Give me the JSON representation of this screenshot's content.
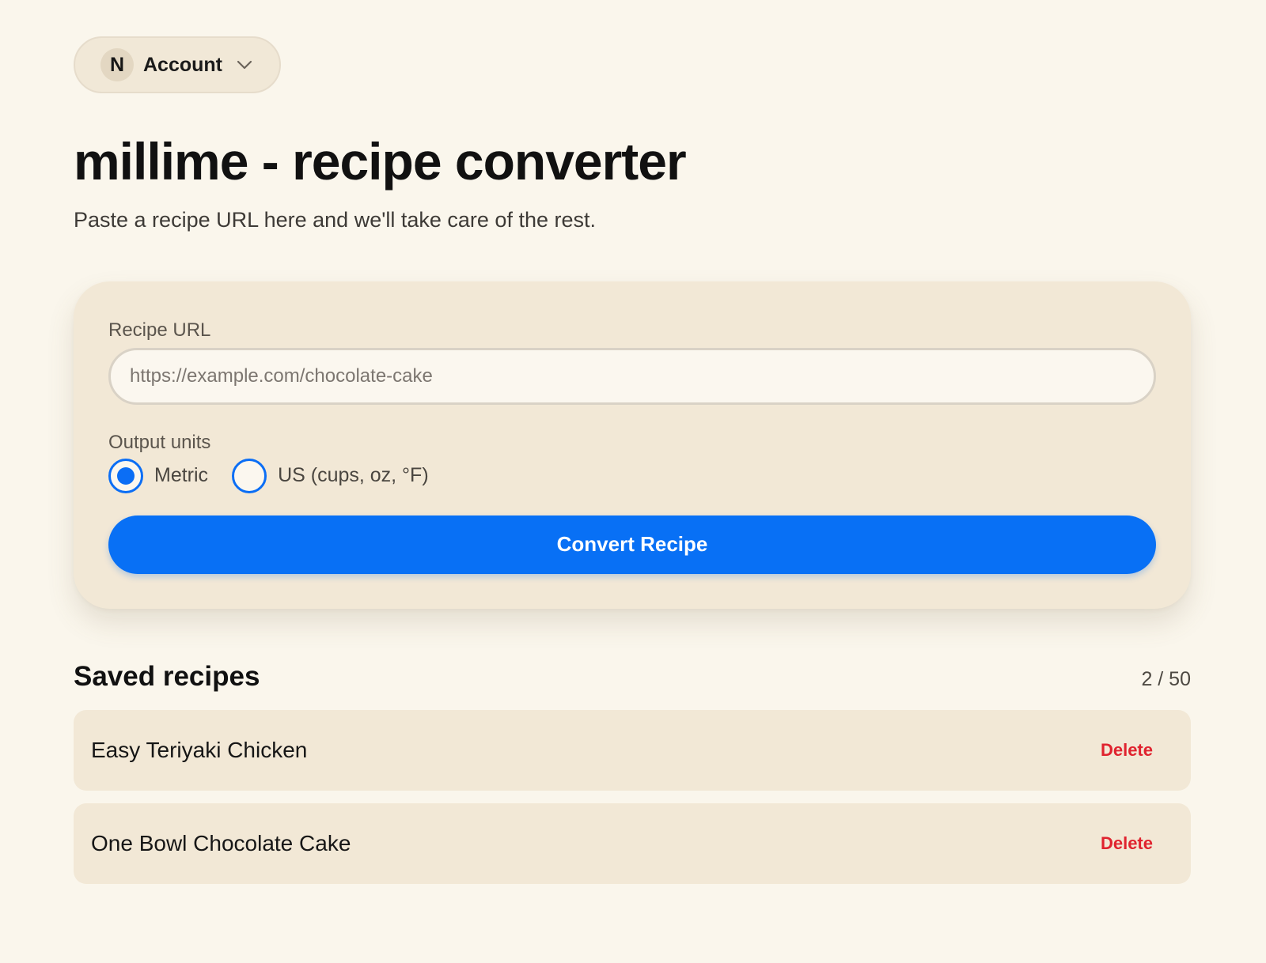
{
  "account": {
    "avatar_initial": "N",
    "label": "Account",
    "chevron_icon": "chevron-down-icon"
  },
  "header": {
    "title": "millime - recipe converter",
    "subtitle": "Paste a recipe URL here and we'll take care of the rest."
  },
  "form": {
    "url_label": "Recipe URL",
    "url_value": "",
    "url_placeholder": "https://example.com/chocolate-cake",
    "units_label": "Output units",
    "units_options": [
      {
        "label": "Metric",
        "selected": true
      },
      {
        "label": "US (cups, oz, °F)",
        "selected": false
      }
    ],
    "convert_label": "Convert Recipe"
  },
  "saved": {
    "title": "Saved recipes",
    "count": "2 / 50",
    "items": [
      {
        "name": "Easy Teriyaki Chicken",
        "delete_label": "Delete"
      },
      {
        "name": "One Bowl Chocolate Cake",
        "delete_label": "Delete"
      }
    ]
  },
  "colors": {
    "background": "#faf6ec",
    "card": "#f2e8d6",
    "accent": "#0870f5",
    "danger": "#e0232f"
  }
}
